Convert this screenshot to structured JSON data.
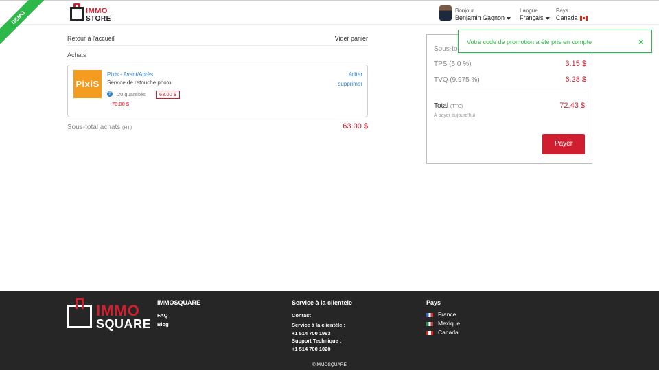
{
  "ribbon": {
    "label": "DEMO",
    "color": "#2db84a"
  },
  "header": {
    "logo_top": "IMMO",
    "logo_bottom": "STORE",
    "greeting": "Bonjour",
    "user_name": "Benjamin Gagnon",
    "language_label": "Langue",
    "language_value": "Français",
    "country_label": "Pays",
    "country_value": "Canada"
  },
  "cart": {
    "back_link": "Retour à l'accueil",
    "empty_link": "Vider panier",
    "section_title": "Achats",
    "item": {
      "logo_text": "PixiS",
      "name": "Pixis - Avant/Après",
      "description": "Service de retouche photo",
      "quantity": "20 quantités",
      "price": "63.00 $",
      "old_price": "70.00 $",
      "edit_label": "éditer",
      "remove_label": "supprimer",
      "help_icon": "question-icon"
    },
    "subtotal_label": "Sous-total achats",
    "subtotal_suffix": "(HT)",
    "subtotal_value": "63.00 $"
  },
  "summary": {
    "subtotal_label": "Sous-to",
    "tps_label": "TPS (5.0 %)",
    "tps_value": "3.15 $",
    "tvq_label": "TVQ (9.975 %)",
    "tvq_value": "6.28 $",
    "total_label": "Total",
    "total_suffix": "(TTC)",
    "total_value": "72.43 $",
    "pay_today": "À payer aujourd'hui",
    "pay_button": "Payer"
  },
  "toast": {
    "message": "Votre code de promotion a été pris en compte",
    "close": "×"
  },
  "footer": {
    "logo_top": "IMMO",
    "logo_bottom": "SQUARE",
    "col1_title": "IMMOSQUARE",
    "col1_links": [
      "FAQ",
      "Blog"
    ],
    "col2_title": "Service à la clientèle",
    "contact": "Contact",
    "service_label": "Service à la clientèle :",
    "service_phone": "+1 514 700 1963",
    "support_label": "Support Technique :",
    "support_phone": "+1 514 700 1020",
    "col3_title": "Pays",
    "countries": [
      "France",
      "Mexique",
      "Canada"
    ],
    "copyright": "©IMMOSQUARE"
  },
  "colors": {
    "accent_red": "#d0202f",
    "link_blue": "#2f7fc5",
    "success_green": "#2eb84c",
    "footer_bg": "#262626"
  }
}
